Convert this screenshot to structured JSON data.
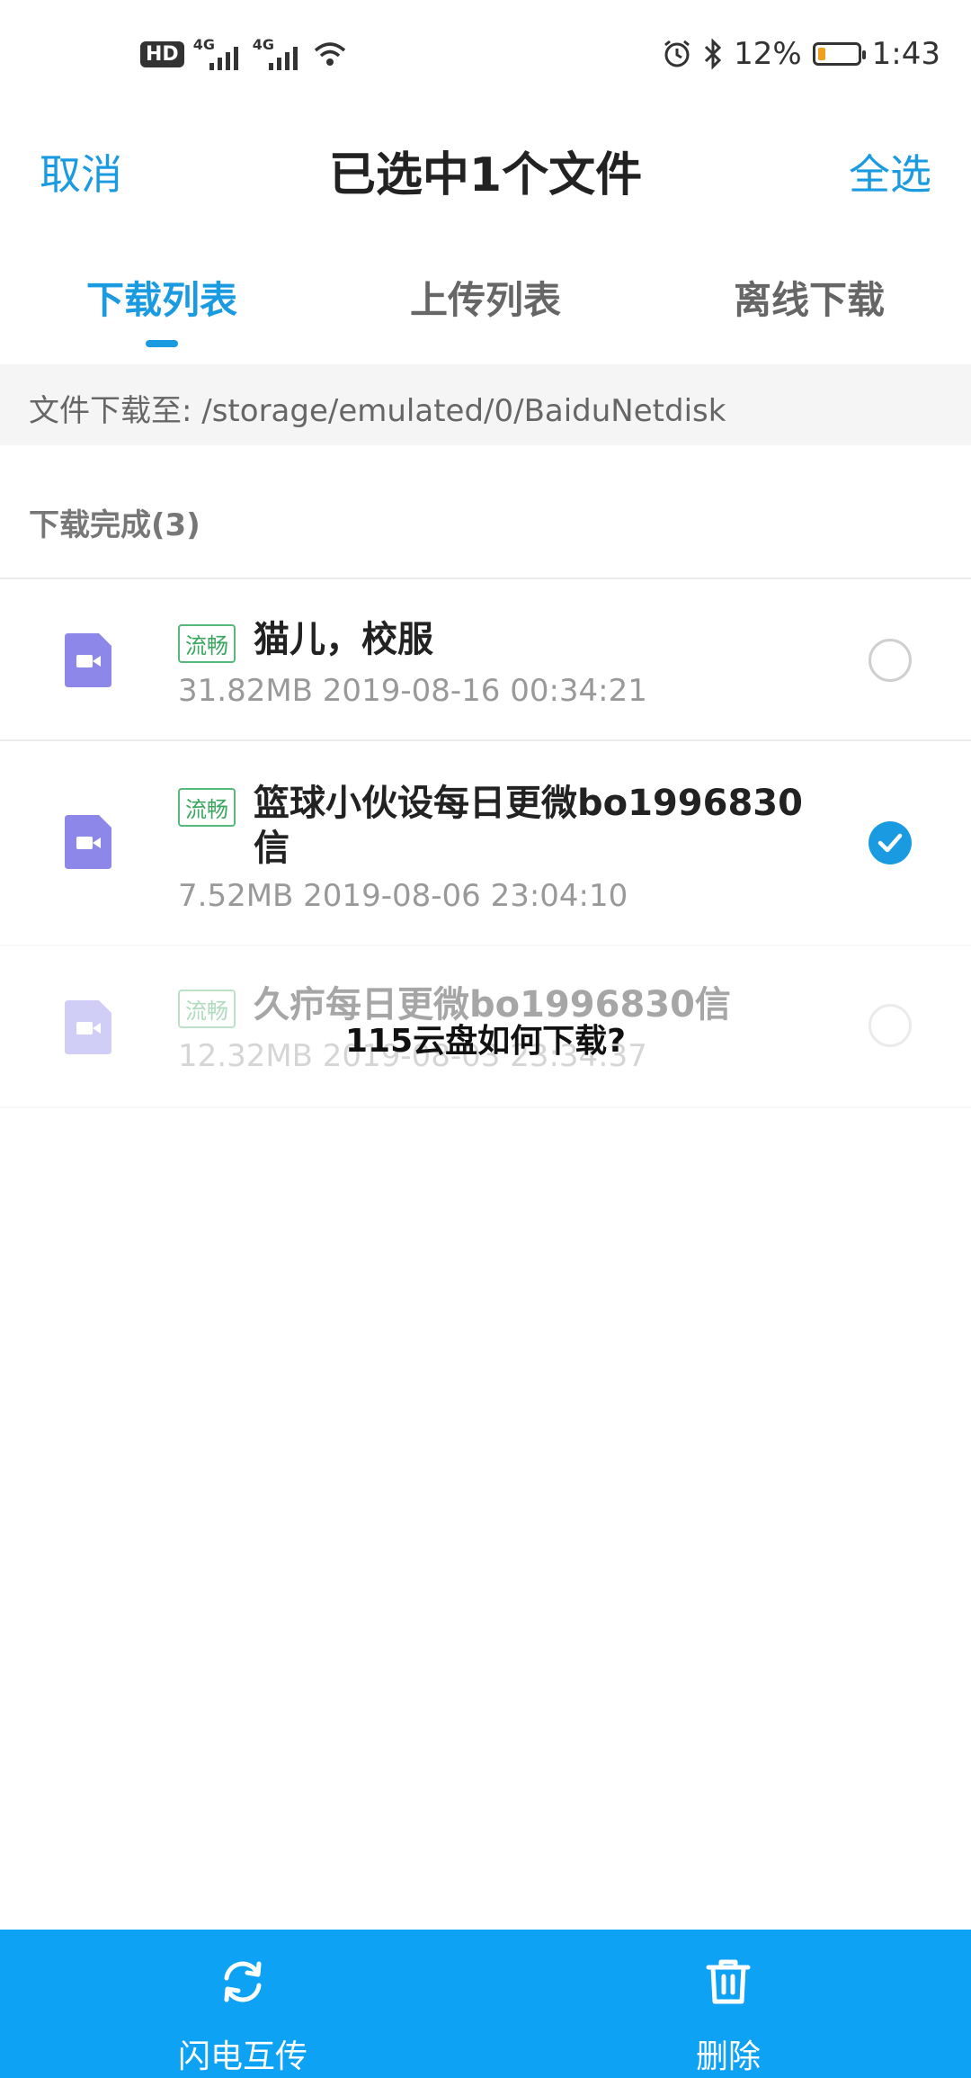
{
  "status_bar": {
    "hd": "HD",
    "signal1": "4G",
    "signal2": "4G",
    "battery": "12%",
    "time": "1:43",
    "icons": [
      "alarm-icon",
      "bluetooth-icon",
      "wifi-icon",
      "battery-icon"
    ]
  },
  "header": {
    "cancel": "取消",
    "title": "已选中1个文件",
    "select_all": "全选"
  },
  "tabs": [
    {
      "label": "下载列表",
      "active": true
    },
    {
      "label": "上传列表",
      "active": false
    },
    {
      "label": "离线下载",
      "active": false
    }
  ],
  "path": "文件下载至: /storage/emulated/0/BaiduNetdisk",
  "section": {
    "title": "下载完成(3)"
  },
  "files": [
    {
      "badge": "流畅",
      "name": "猫儿，校服",
      "meta": "31.82MB 2019-08-16 00:34:21",
      "checked": false
    },
    {
      "badge": "流畅",
      "name": "篮球小伙设每日更微bo1996830信",
      "meta": "7.52MB 2019-08-06 23:04:10",
      "checked": true
    },
    {
      "badge": "流畅",
      "name": "久疖每日更微bo1996830信",
      "meta": "12.32MB 2019-08-03 23:34:37",
      "checked": false
    }
  ],
  "watermark": "115云盘如何下载?",
  "bottom_bar": {
    "transfer": "闪电互传",
    "delete": "删除"
  },
  "colors": {
    "accent": "#1a9ae0",
    "bottom_bar": "#0ea2f5",
    "badge_green": "#3aa65e",
    "file_icon": "#8c87e9"
  }
}
